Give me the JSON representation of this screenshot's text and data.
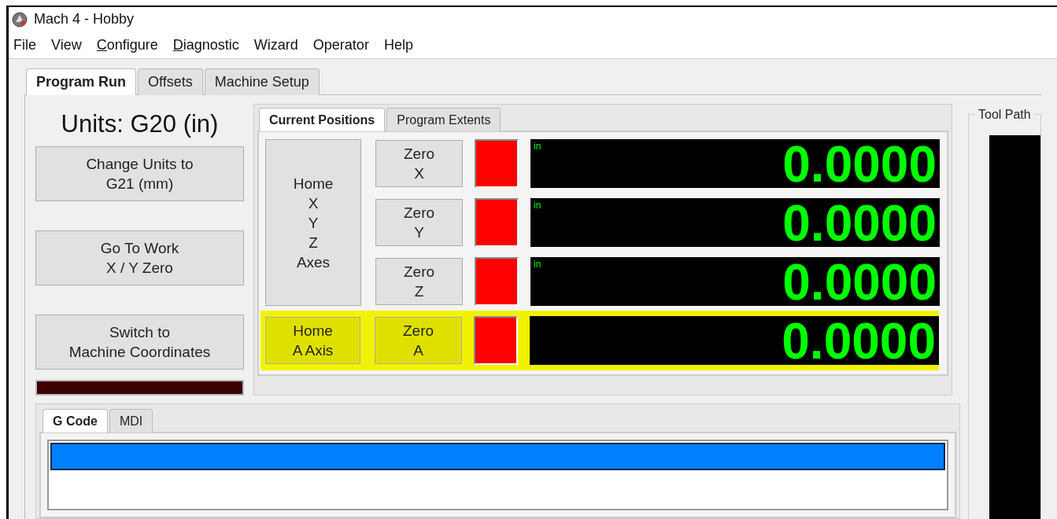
{
  "window": {
    "title": "Mach 4 - Hobby"
  },
  "menu": [
    {
      "label": "File",
      "mnemonic": false
    },
    {
      "label": "View",
      "mnemonic": false
    },
    {
      "label": "Configure",
      "mnemonic": true
    },
    {
      "label": "Diagnostic",
      "mnemonic": true
    },
    {
      "label": "Wizard",
      "mnemonic": false
    },
    {
      "label": "Operator",
      "mnemonic": false
    },
    {
      "label": "Help",
      "mnemonic": false
    }
  ],
  "tabs": [
    {
      "label": "Program Run",
      "selected": true
    },
    {
      "label": "Offsets",
      "selected": false
    },
    {
      "label": "Machine Setup",
      "selected": false
    }
  ],
  "left_panel": {
    "units": "Units: G20 (in)",
    "buttons": [
      "Change Units to\nG21 (mm)",
      "Go To Work\nX / Y Zero",
      "Switch to\nMachine Coordinates"
    ]
  },
  "positions": {
    "tabs": [
      {
        "label": "Current Positions",
        "selected": true
      },
      {
        "label": "Program Extents",
        "selected": false
      }
    ],
    "home_button": "Home\nX\nY\nZ\nAxes",
    "axes": [
      {
        "zero_button": "Zero\nX",
        "unit": "in",
        "value": "0.0000"
      },
      {
        "zero_button": "Zero\nY",
        "unit": "in",
        "value": "0.0000"
      },
      {
        "zero_button": "Zero\nZ",
        "unit": "in",
        "value": "0.0000"
      }
    ],
    "a_axis": {
      "home_button": "Home\nA Axis",
      "zero_button": "Zero\nA",
      "value": "0.0000"
    }
  },
  "tool_path": {
    "title": "Tool Path"
  },
  "gcode": {
    "tabs": [
      {
        "label": "G Code",
        "selected": true
      },
      {
        "label": "MDI",
        "selected": false
      }
    ]
  }
}
